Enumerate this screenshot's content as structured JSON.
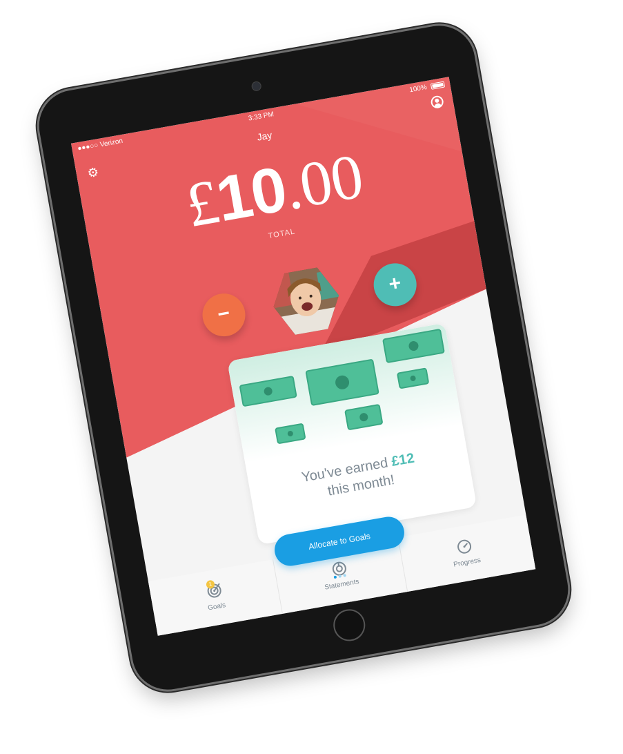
{
  "status_bar": {
    "carrier": "●●●○○ Verizon",
    "time": "3:33 PM",
    "battery": "100%"
  },
  "header": {
    "child_name": "Jay"
  },
  "balance": {
    "currency": "£",
    "whole": "10",
    "pence": ".00",
    "label": "TOTAL"
  },
  "actions": {
    "minus": "−",
    "plus": "+"
  },
  "card": {
    "line1_prefix": "You've earned ",
    "earned_amount": "£12",
    "line2": "this month!"
  },
  "cta": {
    "label": "Allocate to Goals"
  },
  "tabs": [
    {
      "label": "Goals",
      "icon": "target-icon",
      "badge": "1"
    },
    {
      "label": "Statements",
      "icon": "statements-icon"
    },
    {
      "label": "Progress",
      "icon": "gauge-icon"
    }
  ],
  "colors": {
    "header_red": "#e85c5e",
    "dark_red": "#c94446",
    "minus_orange": "#f07046",
    "plus_teal": "#4fbdb5",
    "cta_blue": "#1a9ee3",
    "money_green": "#4fbf98"
  }
}
